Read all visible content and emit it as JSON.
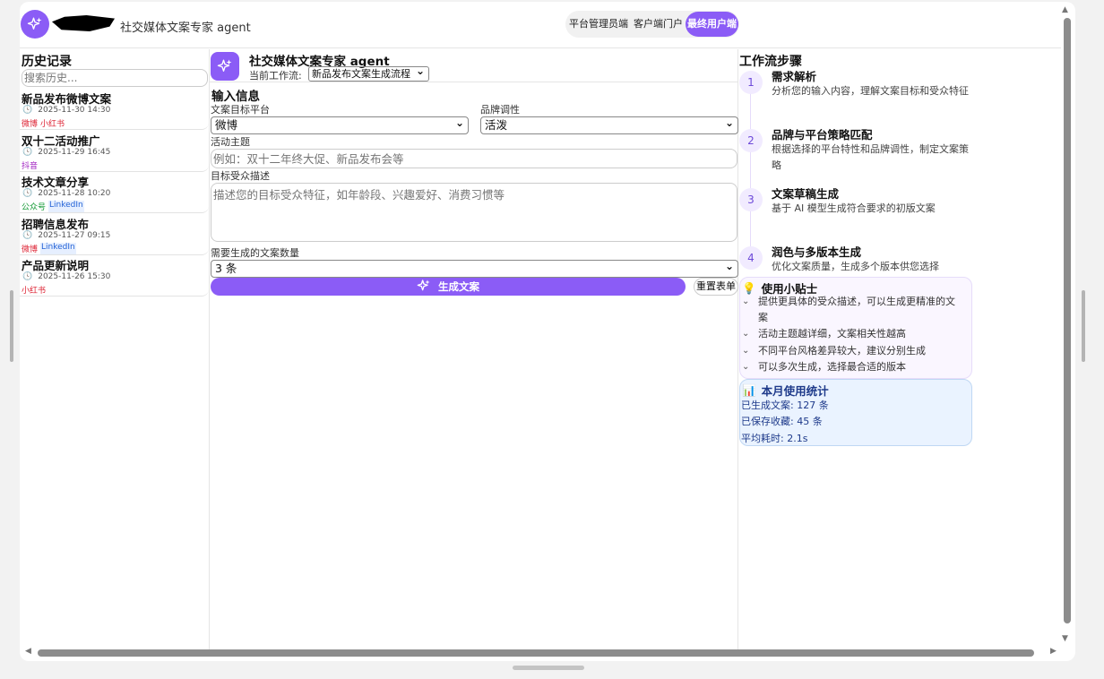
{
  "header": {
    "app_title": "社交媒体文案专家 agent",
    "roles": [
      "平台管理员端",
      "客户端门户",
      "最终用户端"
    ],
    "active_role": "最终用户端"
  },
  "history": {
    "title": "历史记录",
    "search_placeholder": "搜索历史...",
    "items": [
      {
        "title": "新品发布微博文案",
        "time": "2025-11-30 14:30",
        "tags": [
          "微博",
          "小红书"
        ]
      },
      {
        "title": "双十二活动推广",
        "time": "2025-11-29 16:45",
        "tags": [
          "抖音"
        ]
      },
      {
        "title": "技术文章分享",
        "time": "2025-11-28 10:20",
        "tags": [
          "公众号",
          "LinkedIn"
        ]
      },
      {
        "title": "招聘信息发布",
        "time": "2025-11-27 09:15",
        "tags": [
          "微博",
          "LinkedIn"
        ]
      },
      {
        "title": "产品更新说明",
        "time": "2025-11-26 15:30",
        "tags": [
          "小红书"
        ]
      }
    ]
  },
  "agent": {
    "name": "社交媒体文案专家 agent",
    "workflow_label": "当前工作流:",
    "workflow_value": "新品发布文案生成流程"
  },
  "form": {
    "title": "输入信息",
    "platform_label": "文案目标平台",
    "platform_value": "微博",
    "tone_label": "品牌调性",
    "tone_value": "活泼",
    "topic_label": "活动主题",
    "topic_placeholder": "例如：双十二年终大促、新品发布会等",
    "audience_label": "目标受众描述",
    "audience_placeholder": "描述您的目标受众特征，如年龄段、兴趣爱好、消费习惯等",
    "count_label": "需要生成的文案数量",
    "count_value": "3 条",
    "generate_button": "生成文案",
    "reset_button": "重置表单"
  },
  "workflow": {
    "title": "工作流步骤",
    "steps": [
      {
        "num": "1",
        "title": "需求解析",
        "desc": "分析您的输入内容，理解文案目标和受众特征"
      },
      {
        "num": "2",
        "title": "品牌与平台策略匹配",
        "desc": "根据选择的平台特性和品牌调性，制定文案策略"
      },
      {
        "num": "3",
        "title": "文案草稿生成",
        "desc": "基于 AI 模型生成符合要求的初版文案"
      },
      {
        "num": "4",
        "title": "润色与多版本生成",
        "desc": "优化文案质量，生成多个版本供您选择"
      }
    ]
  },
  "tips": {
    "title": "使用小贴士",
    "items": [
      "提供更具体的受众描述，可以生成更精准的文案",
      "活动主题越详细，文案相关性越高",
      "不同平台风格差异较大，建议分别生成",
      "可以多次生成，选择最合适的版本"
    ]
  },
  "stats": {
    "title": "本月使用统计",
    "generated": "已生成文案: 127 条",
    "saved": "已保存收藏: 45 条",
    "avg_time": "平均耗时: 2.1s"
  },
  "colors": {
    "accent": "#8b5cf6",
    "stats_text": "#1e3a8a"
  }
}
